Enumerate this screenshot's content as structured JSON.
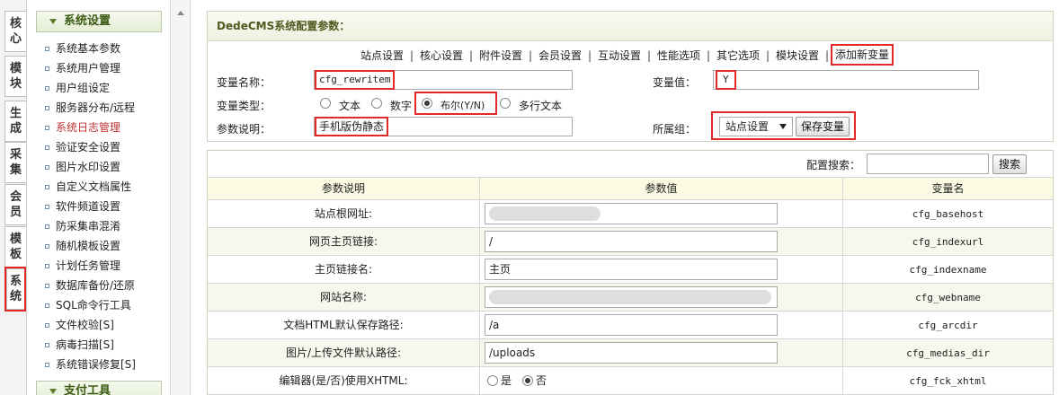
{
  "left_tabs": [
    {
      "c1": "核",
      "c2": "心"
    },
    {
      "c1": "模",
      "c2": "块"
    },
    {
      "c1": "生",
      "c2": "成"
    },
    {
      "c1": "采",
      "c2": "集"
    },
    {
      "c1": "会",
      "c2": "员"
    },
    {
      "c1": "模",
      "c2": "板"
    },
    {
      "c1": "系",
      "c2": "统"
    }
  ],
  "sidebar": {
    "heading": "系统设置",
    "items": [
      "系统基本参数",
      "系统用户管理",
      "用户组设定",
      "服务器分布/远程",
      "系统日志管理",
      "验证安全设置",
      "图片水印设置",
      "自定义文档属性",
      "软件频道设置",
      "防采集串混淆",
      "随机模板设置",
      "计划任务管理",
      "数据库备份/还原",
      "SQL命令行工具",
      "文件校验[S]",
      "病毒扫描[S]",
      "系统错误修复[S]"
    ],
    "heading2": "支付工具"
  },
  "panel": {
    "title": "DedeCMS系统配置参数：",
    "tabs": [
      "站点设置",
      "核心设置",
      "附件设置",
      "会员设置",
      "互动设置",
      "性能选项",
      "其它选项",
      "模块设置",
      "添加新变量"
    ],
    "var_name_label": "变量名称：",
    "var_name_value": "cfg_rewritem",
    "var_value_label": "变量值：",
    "var_value_value": "Y",
    "var_type_label": "变量类型：",
    "type_options": [
      "文本",
      "数字",
      "布尔(Y/N)",
      "多行文本"
    ],
    "desc_label": "参数说明：",
    "desc_value": "手机版伪静态",
    "group_label": "所属组：",
    "group_value": "站点设置",
    "save_btn": "保存变量"
  },
  "table": {
    "search_label": "配置搜索：",
    "search_value": "",
    "search_btn": "搜索",
    "headers": [
      "参数说明",
      "参数值",
      "变量名"
    ],
    "rows": [
      {
        "desc": "站点根网址:",
        "value": "",
        "var": "cfg_basehost"
      },
      {
        "desc": "网页主页链接:",
        "value": "/",
        "var": "cfg_indexurl"
      },
      {
        "desc": "主页链接名:",
        "value": "主页",
        "var": "cfg_indexname"
      },
      {
        "desc": "网站名称:",
        "value": "",
        "var": "cfg_webname"
      },
      {
        "desc": "文档HTML默认保存路径:",
        "value": "/a",
        "var": "cfg_arcdir"
      },
      {
        "desc": "图片/上传文件默认路径:",
        "value": "/uploads",
        "var": "cfg_medias_dir"
      },
      {
        "desc": "编辑器(是/否)使用XHTML:",
        "value": "",
        "var": "cfg_fck_xhtml"
      }
    ],
    "xhtml_yes": "是",
    "xhtml_no": "否"
  },
  "colors": {
    "highlight": "#e02a2a",
    "sidebar_active": "#c03232",
    "heading": "#3b5a12"
  }
}
